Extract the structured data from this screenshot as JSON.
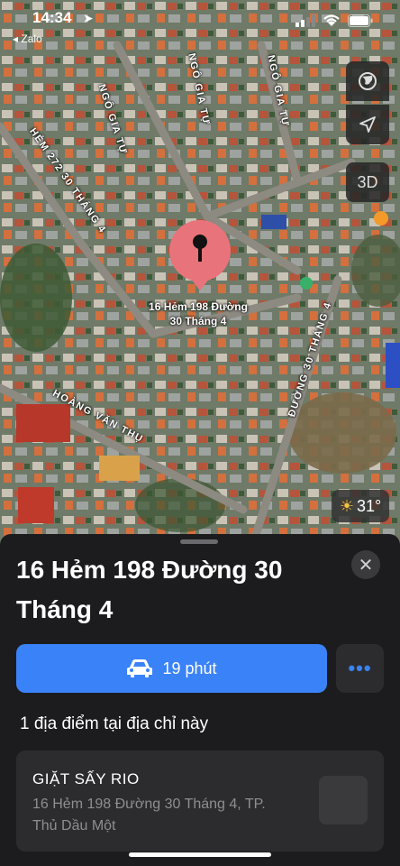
{
  "status_bar": {
    "time": "14:34",
    "back_app": "◂ Zalo"
  },
  "map": {
    "pin_label_line1": "16 Hẻm 198 Đường",
    "pin_label_line2": "30 Tháng 4",
    "streets": {
      "ngo_gia_tu_1": "NGÔ GIA TỰ",
      "ngo_gia_tu_2": "NGÔ GIA TỰ",
      "ngo_gia_tu_3": "NGÔ GIA TỰ",
      "hem_272": "HẺM 272 30 THÁNG 4",
      "duong_30_thang_4": "ĐƯỜNG 30 THÁNG 4",
      "hoang_van_thu": "HOÀNG VĂN THỤ"
    },
    "controls": {
      "view_3d": "3D"
    },
    "weather": {
      "temp": "31°"
    }
  },
  "sheet": {
    "title": "16 Hẻm 198 Đường 30 Tháng 4",
    "directions_label": "19 phút",
    "more_label": "•••",
    "close_label": "✕",
    "section_title": "1 địa điểm tại địa chỉ này",
    "place": {
      "name": "GIẶT SẤY RIO",
      "address": "16 Hẻm 198 Đường 30 Tháng 4, TP. Thủ Dầu Một"
    }
  },
  "colors": {
    "accent": "#3a82f7",
    "pin": "#e9737a",
    "sheet_bg": "#1c1c1e"
  }
}
